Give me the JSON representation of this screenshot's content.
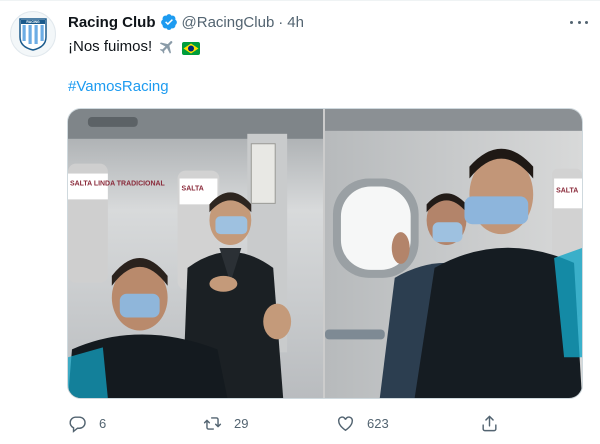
{
  "account": {
    "display_name": "Racing Club",
    "handle": "@RacingClub",
    "separator": "·",
    "time": "4h",
    "verified": true,
    "avatar_label": "RACING",
    "avatar_icon": "racing-club-crest"
  },
  "tweet": {
    "text": "¡Nos fuimos!",
    "emojis": [
      "airplane",
      "brazil-flag"
    ],
    "hashtag": "#VamosRacing"
  },
  "media": {
    "photo_count": 2,
    "left_photo_sign": "SALTA LINDA TRADICIONAL",
    "right_photo_sign": "SALTA"
  },
  "actions": {
    "reply_count": "6",
    "retweet_count": "29",
    "like_count": "623"
  },
  "colors": {
    "link": "#1d9bf0",
    "secondary_text": "#536471",
    "verified": "#1d9bf0",
    "crest_blue": "#6cace4"
  }
}
